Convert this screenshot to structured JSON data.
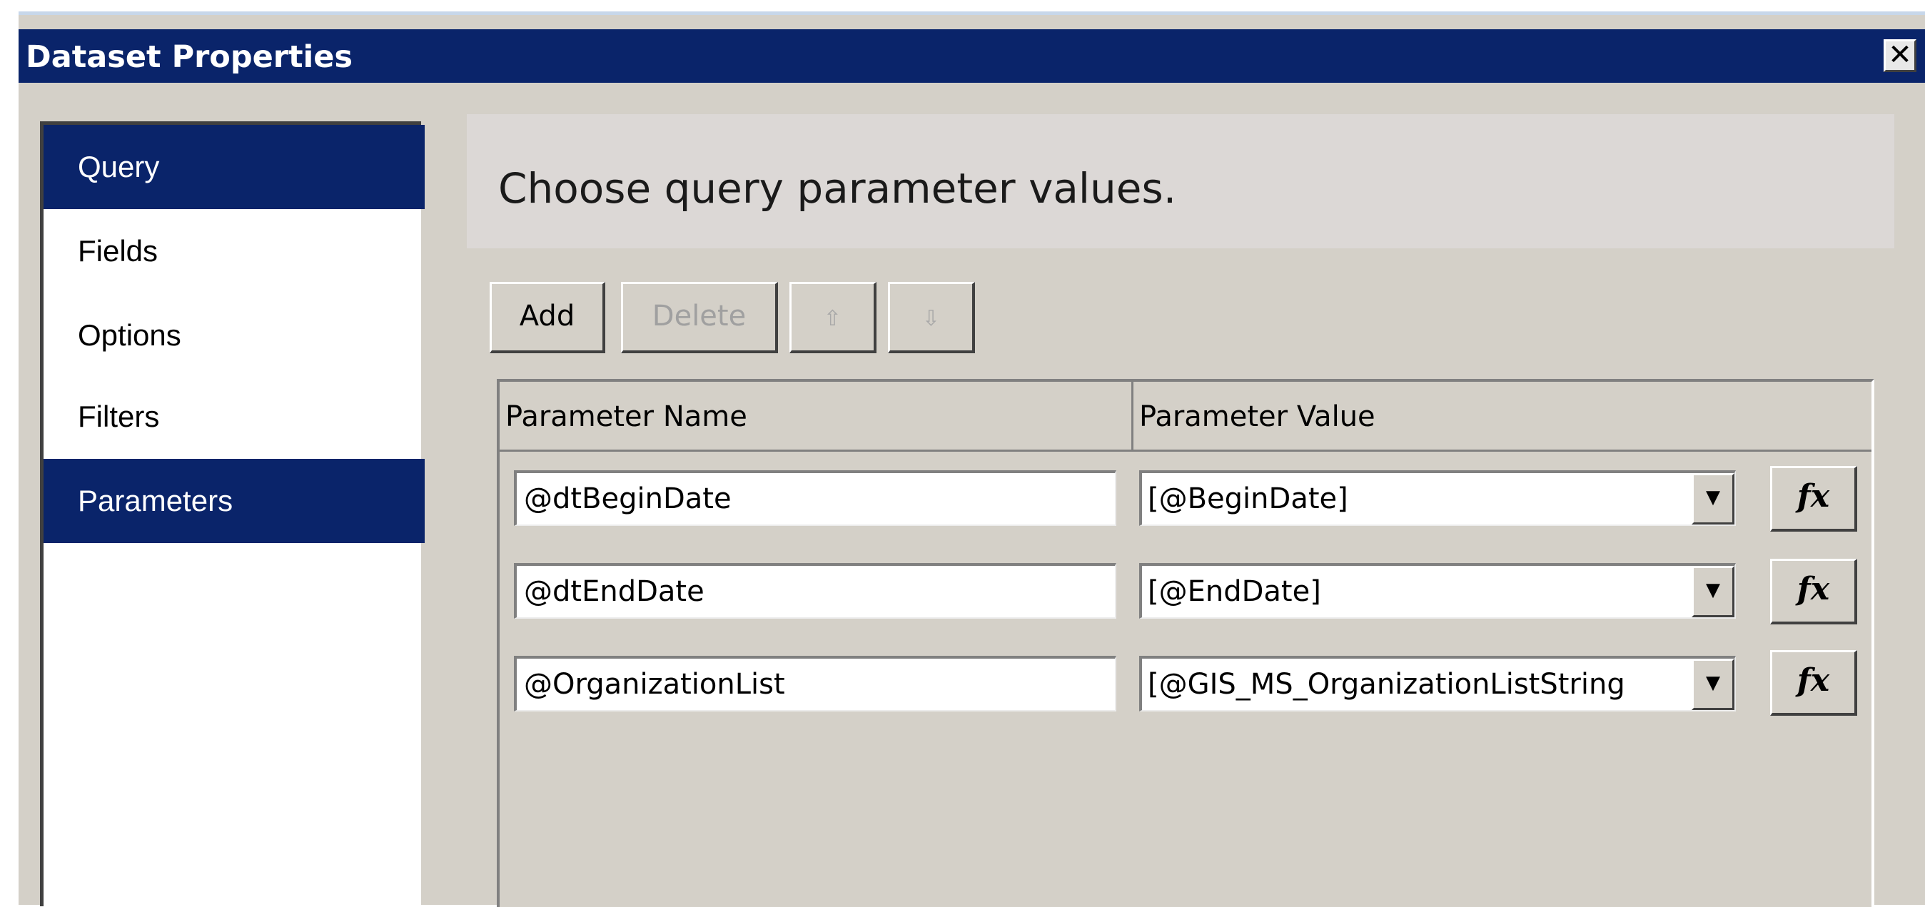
{
  "window": {
    "title": "Dataset Properties",
    "close_label": "✕"
  },
  "nav": {
    "items": [
      {
        "label": "Query",
        "selected": true
      },
      {
        "label": "Fields",
        "selected": false
      },
      {
        "label": "Options",
        "selected": false
      },
      {
        "label": "Filters",
        "selected": false
      },
      {
        "label": "Parameters",
        "selected": true
      }
    ]
  },
  "main": {
    "heading": "Choose query parameter values."
  },
  "toolbar": {
    "add_label": "Add",
    "delete_label": "Delete",
    "move_up_icon": "arrow-up-icon",
    "move_down_icon": "arrow-down-icon",
    "move_up_glyph": "⇧",
    "move_down_glyph": "⇩"
  },
  "grid": {
    "columns": [
      "Parameter Name",
      "Parameter Value"
    ],
    "rows": [
      {
        "name": "@dtBeginDate",
        "value": "[@BeginDate]"
      },
      {
        "name": "@dtEndDate",
        "value": "[@EndDate]"
      },
      {
        "name": "@OrganizationList",
        "value": "[@GIS_MS_OrganizationListString"
      }
    ],
    "dropdown_glyph": "▼",
    "expression_label": "fx"
  },
  "colors": {
    "titlebar": "#0a246a",
    "selection": "#0a246a",
    "dialog_bg": "#d4d0c8"
  }
}
